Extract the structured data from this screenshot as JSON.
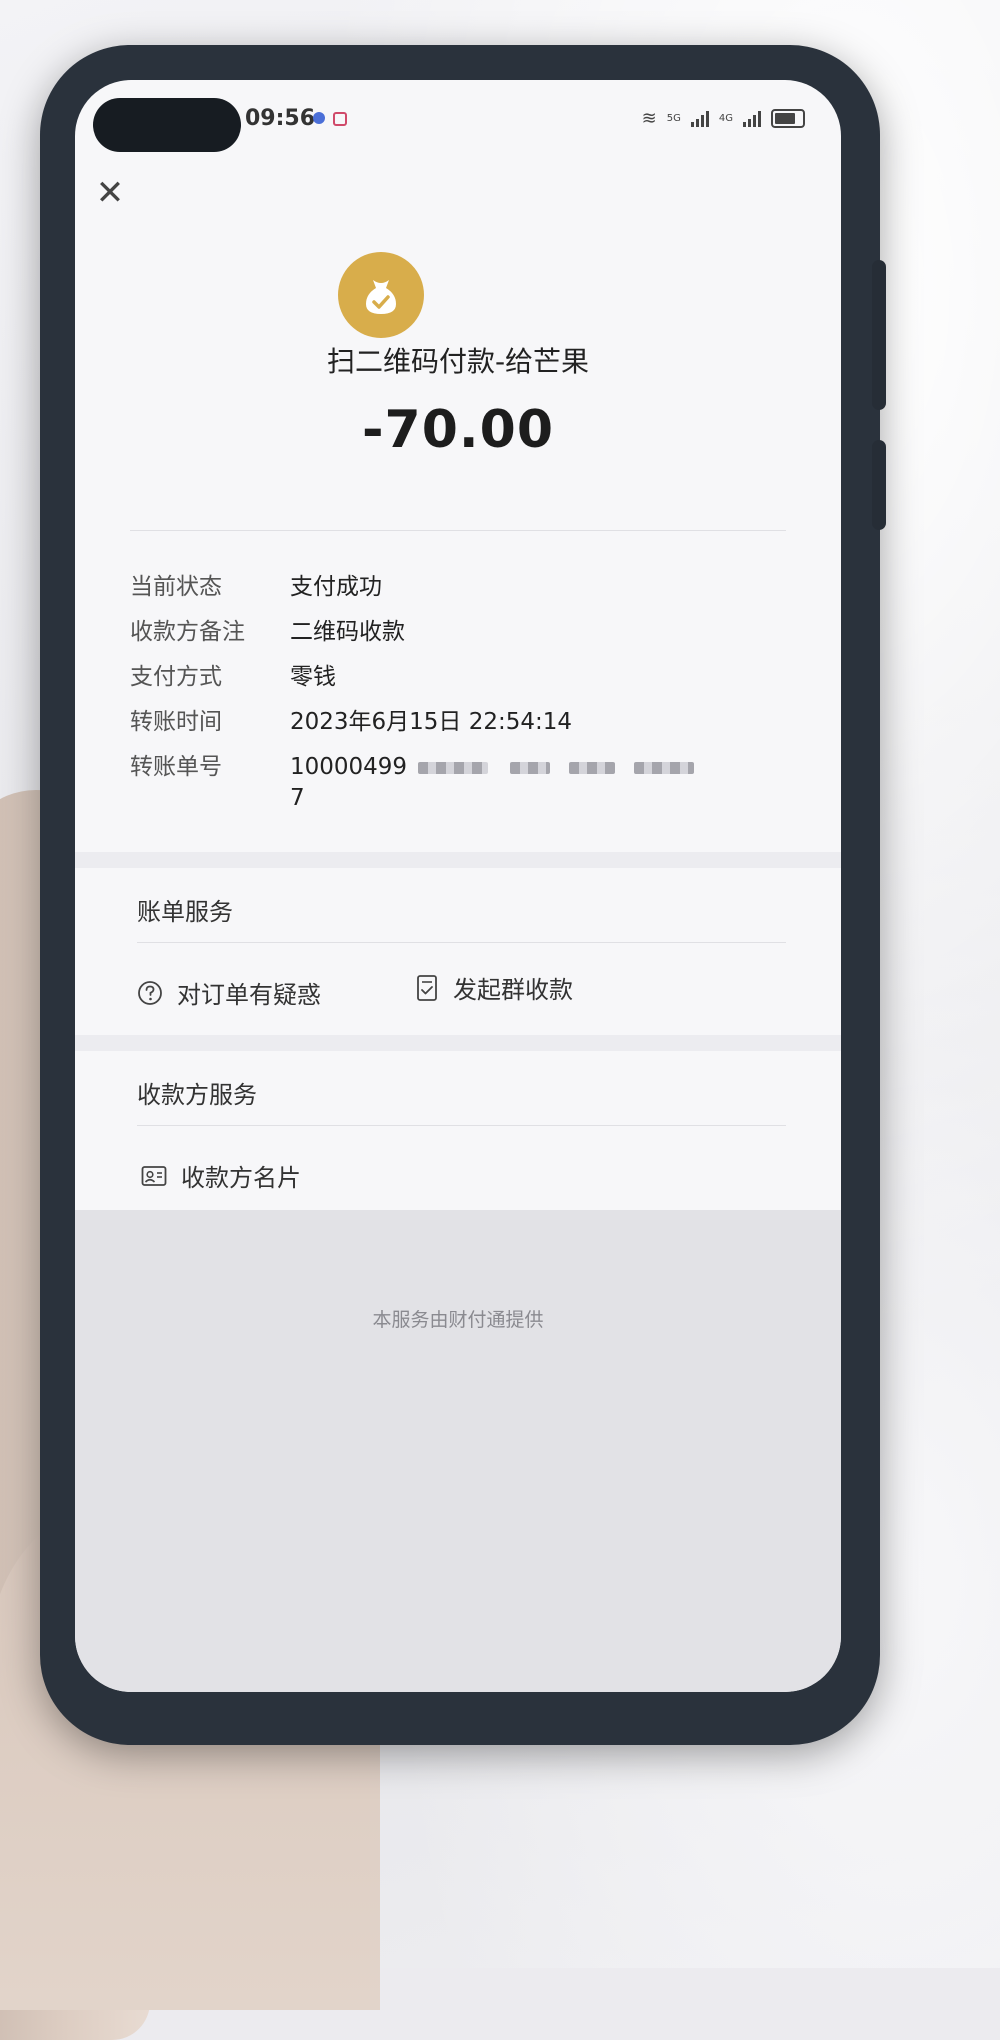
{
  "status_bar": {
    "time": "09:56",
    "signal_1": "5G",
    "signal_2": "4G"
  },
  "header": {
    "close_icon": "close-icon",
    "status_icon": "money-bag-check-icon",
    "title": "扫二维码付款-给芒果",
    "amount": "-70.00",
    "accent_color": "#d8ad4b"
  },
  "details": [
    {
      "label": "当前状态",
      "value": "支付成功"
    },
    {
      "label": "收款方备注",
      "value": "二维码收款"
    },
    {
      "label": "支付方式",
      "value": "零钱"
    },
    {
      "label": "转账时间",
      "value": "2023年6月15日 22:54:14"
    },
    {
      "label": "转账单号",
      "value": "10000499",
      "value_line2": "7"
    }
  ],
  "bill_services": {
    "title": "账单服务",
    "actions": [
      {
        "label": "对订单有疑惑",
        "icon": "question-circle-icon"
      },
      {
        "label": "发起群收款",
        "icon": "document-check-icon"
      }
    ]
  },
  "payee_services": {
    "title": "收款方服务",
    "actions": [
      {
        "label": "收款方名片",
        "icon": "contact-card-icon"
      }
    ]
  },
  "footer": {
    "text": "本服务由财付通提供"
  }
}
